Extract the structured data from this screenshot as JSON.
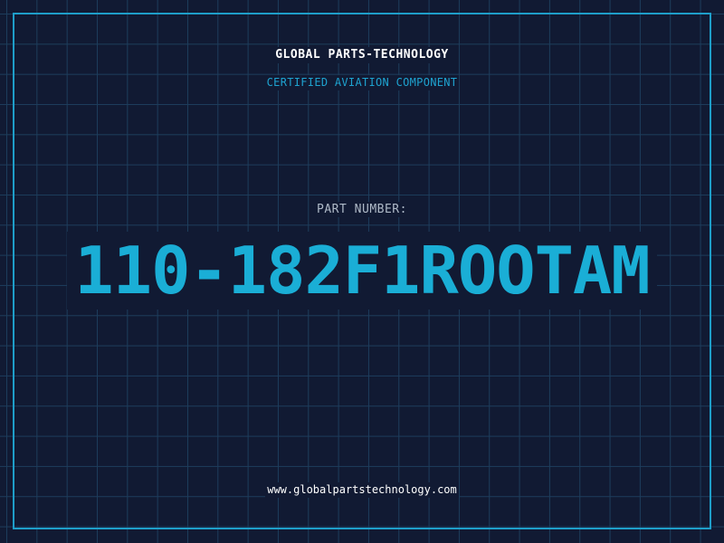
{
  "brand": {
    "name": "GLOBAL PARTS-TECHNOLOGY",
    "tagline": "CERTIFIED AVIATION COMPONENT"
  },
  "part": {
    "label": "PART NUMBER:",
    "number": "110-182F1ROOTAM"
  },
  "footer": {
    "website": "www.globalpartstechnology.com"
  },
  "colors": {
    "background": "#111a33",
    "grid": "#1d3d5c",
    "frame": "#1e9ec9",
    "accent": "#1aaed6",
    "label": "#aeb9c7",
    "text": "#ffffff"
  }
}
